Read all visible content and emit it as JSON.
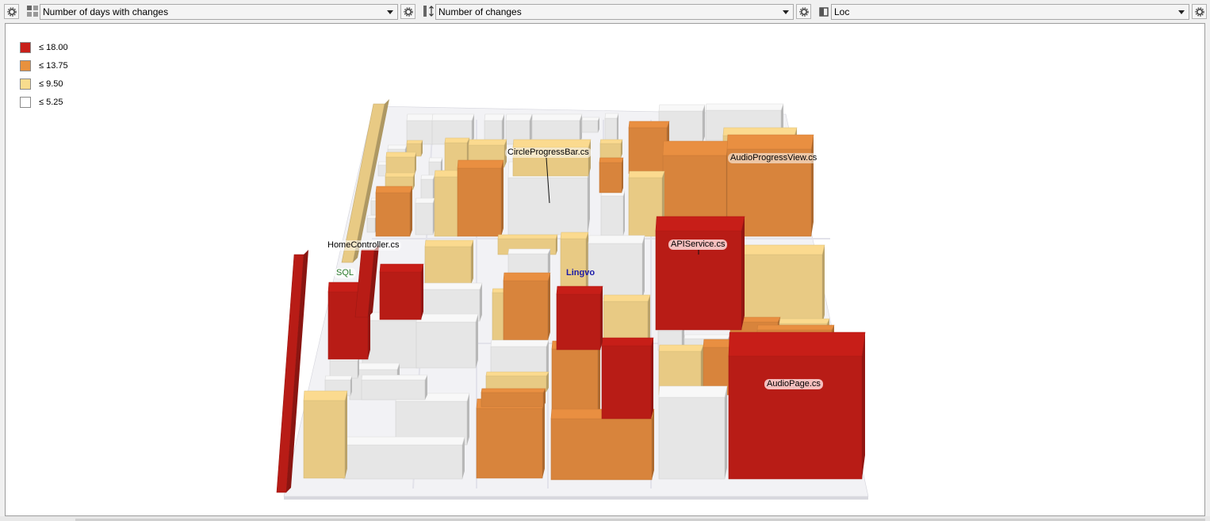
{
  "toolbar": {
    "ground_area": {
      "icon": "treemap-icon",
      "label": "Number of days with changes"
    },
    "height": {
      "icon": "height-icon",
      "label": "Number of changes"
    },
    "color": {
      "icon": "color-bucket-icon",
      "label": "Loc"
    }
  },
  "legend": [
    {
      "label": "≤ 18.00",
      "color": "#c8201a"
    },
    {
      "label": "≤ 13.75",
      "color": "#e8913e"
    },
    {
      "label": "≤ 9.50",
      "color": "#f8dc8e"
    },
    {
      "label": "≤ 5.25",
      "color": "#ffffff"
    }
  ],
  "labels": {
    "circle": "CircleProgressBar.cs",
    "audioprog": "AudioProgressView.cs",
    "home": "HomeController.cs",
    "sql": "SQL",
    "lingvo": "Lingvo",
    "api": "APIService.cs",
    "audiopage": "AudioPage.cs"
  },
  "colors": {
    "red": "#b81c16",
    "orange": "#d8843c",
    "yellow": "#e8ca84",
    "white": "#e6e6e6",
    "base": "#f2f2f5"
  }
}
